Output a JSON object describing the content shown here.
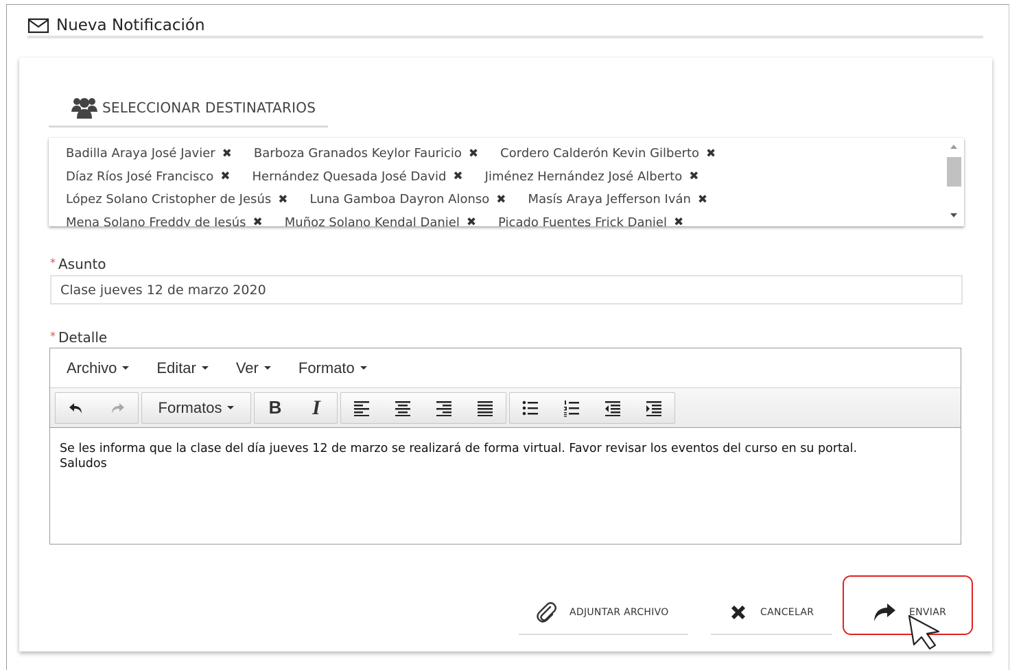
{
  "header": {
    "title": "Nueva Notificación",
    "icon": "envelope-icon"
  },
  "recipients": {
    "tab_label": "SELECCIONAR DESTINATARIOS",
    "icon": "users-icon",
    "remove_glyph": "✖",
    "rows": [
      [
        "Badilla Araya José Javier",
        "Barboza Granados Keylor Fauricio",
        "Cordero Calderón Kevin Gilberto"
      ],
      [
        "Díaz Ríos José Francisco",
        "Hernández Quesada José David",
        "Jiménez Hernández José Alberto"
      ],
      [
        "López Solano Cristopher de Jesús",
        "Luna Gamboa Dayron Alonso",
        "Masís Araya Jefferson Iván"
      ],
      [
        "Mena Solano Freddy de Jesús",
        "Muñoz Solano Kendal Daniel",
        "Picado Fuentes Frick Daniel"
      ]
    ]
  },
  "subject": {
    "label": "Asunto",
    "required_mark": "*",
    "value": "Clase jueves 12 de marzo 2020"
  },
  "detail": {
    "label": "Detalle",
    "required_mark": "*",
    "menu": [
      "Archivo",
      "Editar",
      "Ver",
      "Formato"
    ],
    "toolbar": {
      "formats_label": "Formatos",
      "bold_label": "B",
      "italic_label": "I"
    },
    "body_line1": "Se les informa que la clase del día jueves 12 de marzo se realizará de forma virtual. Favor revisar los eventos del curso en su portal.",
    "body_line2": "Saludos"
  },
  "actions": {
    "attach_label": "ADJUNTAR ARCHIVO",
    "cancel_label": "CANCELAR",
    "send_label": "ENVIAR"
  },
  "colors": {
    "highlight": "#e02020",
    "required": "#d9534f"
  }
}
